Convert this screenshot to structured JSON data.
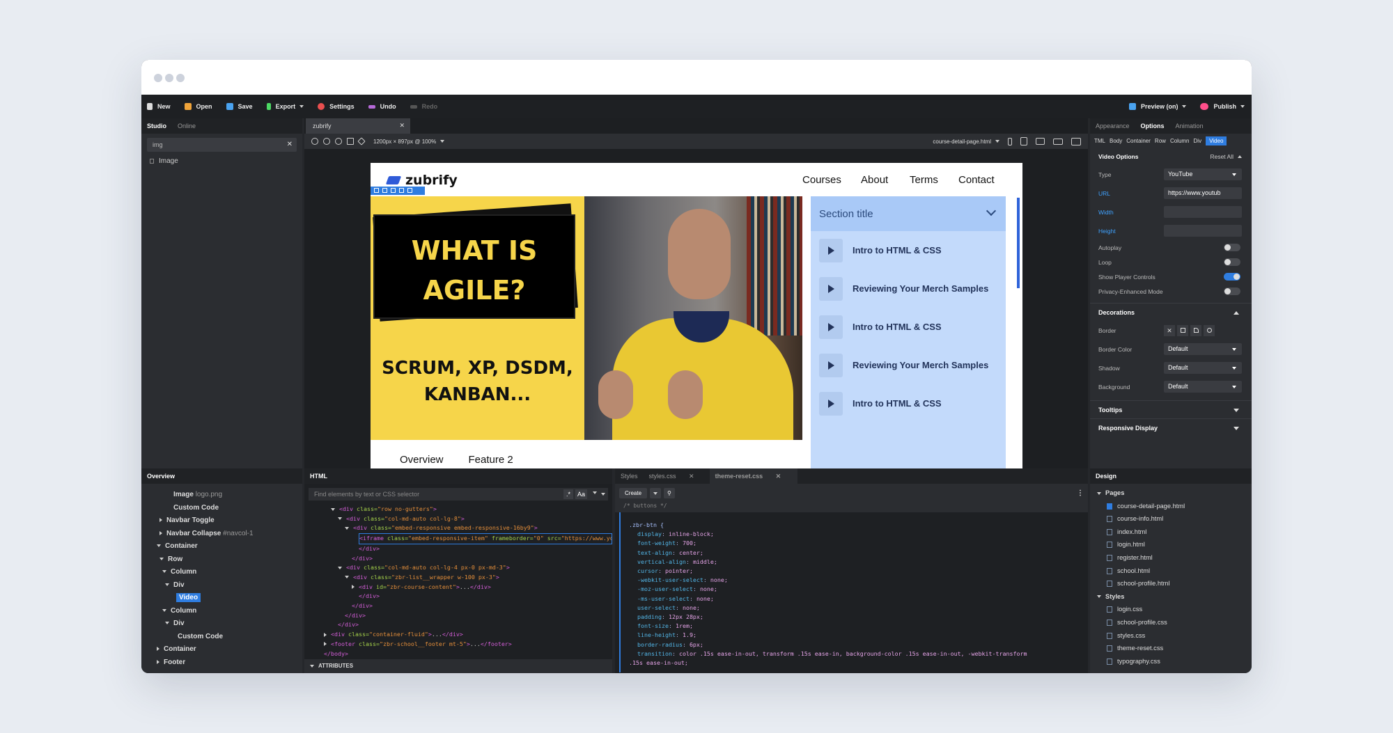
{
  "toolbar": {
    "new": "New",
    "open": "Open",
    "save": "Save",
    "export": "Export",
    "settings": "Settings",
    "undo": "Undo",
    "redo": "Redo",
    "preview": "Preview (on)",
    "publish": "Publish"
  },
  "left": {
    "tabs": [
      "Studio",
      "Online"
    ],
    "search_value": "img",
    "results": [
      "Image"
    ]
  },
  "doc": {
    "tab": "zubrify",
    "size": "1200px × 897px @ 100%",
    "file": "course-detail-page.html"
  },
  "site": {
    "logo": "zubrify",
    "nav": [
      "Courses",
      "About",
      "Terms",
      "Contact"
    ],
    "video_line1": "WHAT IS",
    "video_line2": "AGILE?",
    "video_line3": "SCRUM, XP, DSDM,",
    "video_line4": "KANBAN...",
    "section_title": "Section title",
    "lessons": [
      "Intro to HTML & CSS",
      "Reviewing Your Merch Samples",
      "Intro to HTML & CSS",
      "Reviewing Your Merch Samples",
      "Intro to HTML & CSS"
    ],
    "subtabs": [
      "Overview",
      "Feature 2"
    ]
  },
  "right": {
    "tabs": [
      "Appearance",
      "Options",
      "Animation"
    ],
    "crumbs": [
      "TML",
      "Body",
      "Container",
      "Row",
      "Column",
      "Div",
      "Video"
    ],
    "video_options": "Video Options",
    "reset": "Reset All",
    "type_label": "Type",
    "type_value": "YouTube",
    "url_label": "URL",
    "url_value": "https://www.youtub",
    "width_label": "Width",
    "height_label": "Height",
    "autoplay": "Autoplay",
    "loop": "Loop",
    "controls": "Show Player Controls",
    "privacy": "Privacy-Enhanced Mode",
    "decorations": "Decorations",
    "border": "Border",
    "border_color": "Border Color",
    "shadow": "Shadow",
    "background": "Background",
    "default": "Default",
    "tooltips": "Tooltips",
    "responsive": "Responsive Display",
    "toggles": {
      "autoplay": false,
      "loop": false,
      "controls": true,
      "privacy": false
    }
  },
  "overview": {
    "title": "Overview",
    "image": "Image",
    "image_file": "logo.png",
    "custom_code": "Custom Code",
    "navbar_toggle": "Navbar Toggle",
    "navbar_collapse": "Navbar Collapse",
    "navbar_collapse_id": "#navcol-1",
    "container": "Container",
    "row": "Row",
    "column": "Column",
    "div": "Div",
    "video": "Video",
    "footer": "Footer"
  },
  "html": {
    "title": "HTML",
    "search_placeholder": "Find elements by text or CSS selector",
    "aa": "Aa",
    "attributes": "ATTRIBUTES"
  },
  "styles": {
    "title": "Styles",
    "tab1": "styles.css",
    "tab2": "theme-reset.css",
    "create": "Create",
    "comment": "/* buttons */",
    "selector": ".zbr-btn {",
    "props": [
      [
        "display",
        "inline-block;"
      ],
      [
        "font-weight",
        "700;"
      ],
      [
        "text-align",
        "center;"
      ],
      [
        "vertical-align",
        "middle;"
      ],
      [
        "cursor",
        "pointer;"
      ],
      [
        "-webkit-user-select",
        "none;"
      ],
      [
        "-moz-user-select",
        "none;"
      ],
      [
        "-ms-user-select",
        "none;"
      ],
      [
        "user-select",
        "none;"
      ],
      [
        "padding",
        "12px 28px;"
      ],
      [
        "font-size",
        "1rem;"
      ],
      [
        "line-height",
        "1.9;"
      ],
      [
        "border-radius",
        "6px;"
      ],
      [
        "transition",
        "color .15s ease-in-out, transform .15s ease-in, background-color .15s ease-in-out, -webkit-transform"
      ]
    ],
    "last": ".15s ease-in-out;"
  },
  "design": {
    "title": "Design",
    "pages_label": "Pages",
    "pages": [
      "course-detail-page.html",
      "course-info.html",
      "index.html",
      "login.html",
      "register.html",
      "school.html",
      "school-profile.html"
    ],
    "styles_label": "Styles",
    "styles": [
      "login.css",
      "school-profile.css",
      "styles.css",
      "theme-reset.css",
      "typography.css"
    ]
  }
}
